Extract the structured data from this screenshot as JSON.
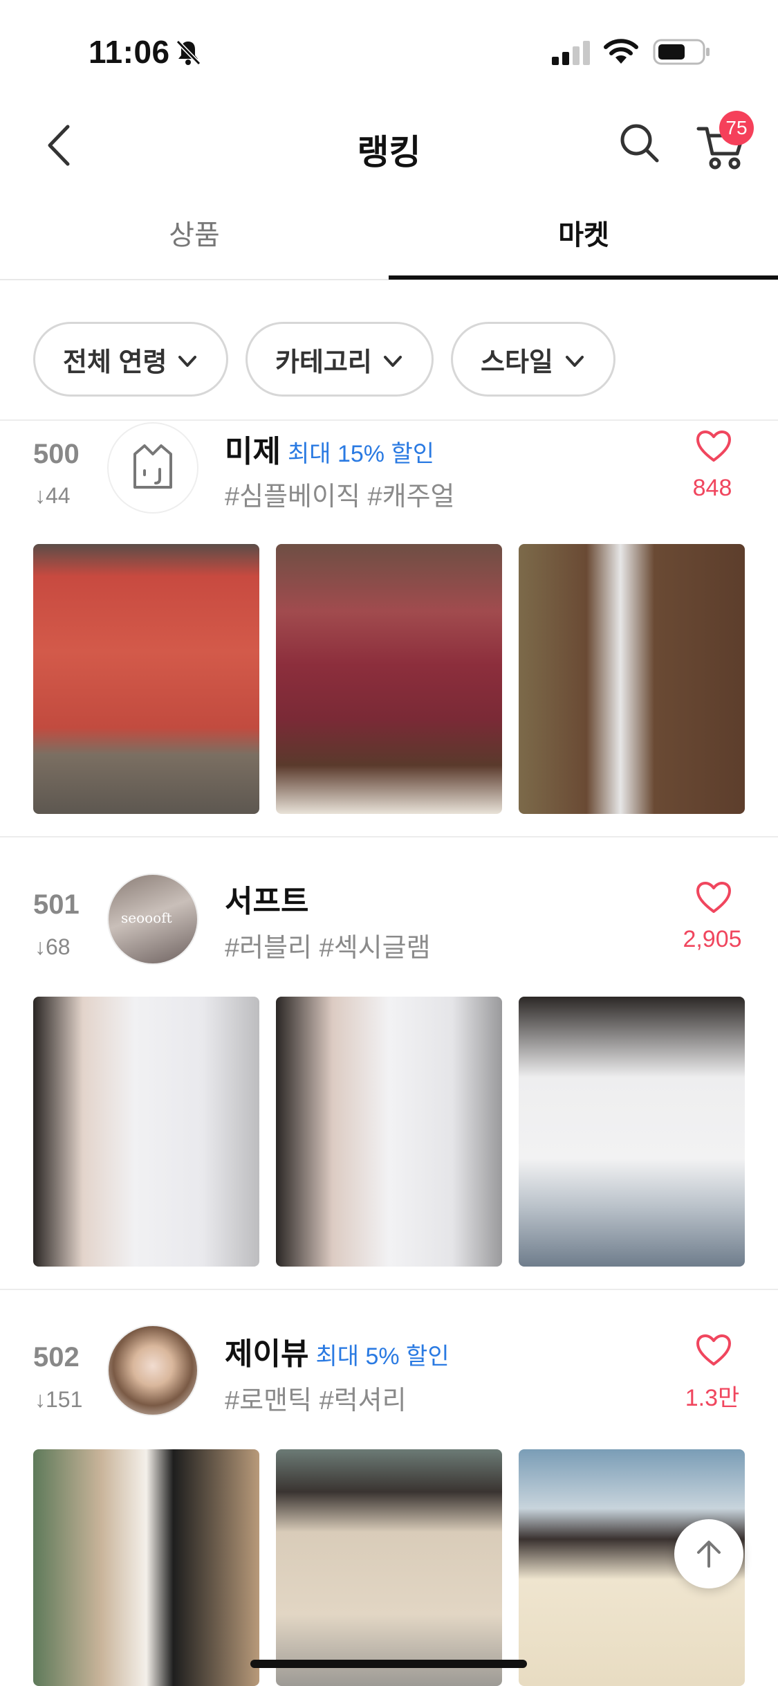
{
  "status_bar": {
    "time": "11:06"
  },
  "nav": {
    "title": "랭킹",
    "cart_count": "75"
  },
  "tabs": [
    {
      "label": "상품",
      "active": false
    },
    {
      "label": "마켓",
      "active": true
    }
  ],
  "filters": [
    {
      "label": "전체 연령"
    },
    {
      "label": "카테고리"
    },
    {
      "label": "스타일"
    }
  ],
  "shops": [
    {
      "rank": "500",
      "rank_change": "↓44",
      "name": "미제",
      "discount": "최대 15% 할인",
      "tags": "#심플베이직 #캐주얼",
      "likes": "848"
    },
    {
      "rank": "501",
      "rank_change": "↓68",
      "name": "서프트",
      "discount": "",
      "tags": "#러블리 #섹시글램",
      "likes": "2,905",
      "avatar_text": "seoooft"
    },
    {
      "rank": "502",
      "rank_change": "↓151",
      "name": "제이뷰",
      "discount": "최대 5% 할인",
      "tags": "#로맨틱 #럭셔리",
      "likes": "1.3만"
    }
  ],
  "colors": {
    "accent_red": "#f0465e",
    "badge_red": "#f5405a",
    "discount_blue": "#2a7ae2"
  }
}
